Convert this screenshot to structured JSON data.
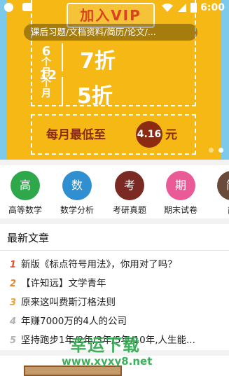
{
  "status_bar": {
    "time": "6:00",
    "icon_colors": [
      "#ffffff",
      "#ffffff"
    ]
  },
  "banner": {
    "vip_label": "加入VIP",
    "search_text": "课后习题/文档资料/简历/论文/...",
    "plans": [
      {
        "months": "6",
        "unit": "个月",
        "discount": "7折"
      },
      {
        "months": "12",
        "unit": "个月",
        "discount": "5折"
      }
    ],
    "lowest_label": "每月最低至",
    "lowest_price": "4.16",
    "currency": "元",
    "page_count": 2,
    "active_page": 1,
    "colors": {
      "sky": "#7dc9ec",
      "gold": "#f5b814",
      "brown": "#8a2b12"
    }
  },
  "categories": [
    {
      "icon_char": "高",
      "label": "高等数学",
      "color": "#2ea84b"
    },
    {
      "icon_char": "数",
      "label": "数学分析",
      "color": "#2f8fd0"
    },
    {
      "icon_char": "考",
      "label": "考研真题",
      "color": "#7a2a22"
    },
    {
      "icon_char": "期",
      "label": "期末试卷",
      "color": "#ea5a96"
    },
    {
      "icon_char": "简",
      "label": "简",
      "color": "#6a4a3a"
    }
  ],
  "articles": {
    "title": "最新文章",
    "items": [
      {
        "rank": "1",
        "title": "新版《标点符号用法》，你用对了吗？",
        "rank_color": "#e0522a"
      },
      {
        "rank": "2",
        "title": "【许知远】文学青年",
        "rank_color": "#e8822a"
      },
      {
        "rank": "3",
        "title": "原来这叫费斯汀格法则",
        "rank_color": "#f0a030"
      },
      {
        "rank": "4",
        "title": "年赚7000万的4人的公司",
        "rank_color": "#b0b0b0"
      },
      {
        "rank": "5",
        "title": "坚持跑步1年/2年/3年/5年/10年,人生能...",
        "rank_color": "#b0b0b0"
      }
    ]
  },
  "watermark": {
    "brand": "幸运下载",
    "url": "www.xyxy8.net"
  }
}
